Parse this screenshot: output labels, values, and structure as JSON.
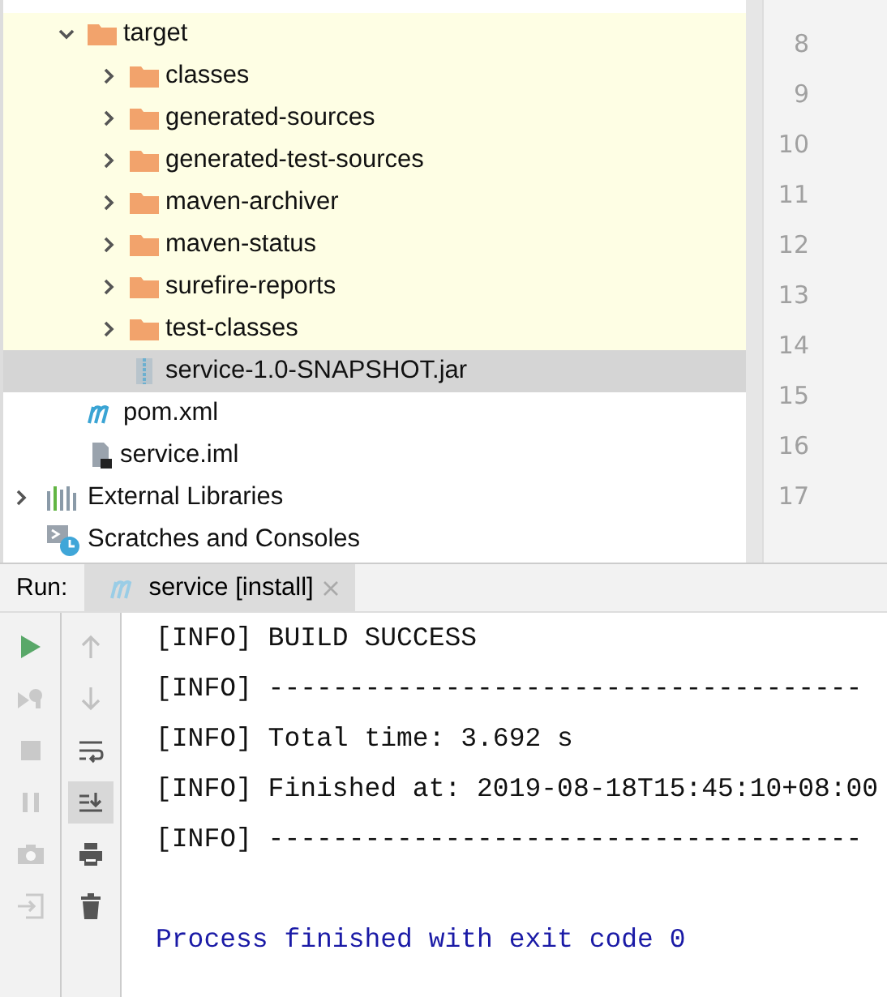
{
  "project_tree": {
    "module_items": [
      {
        "label": "target",
        "kind": "folder",
        "expanded": true,
        "excluded": true,
        "selected": false,
        "children": [
          {
            "label": "classes",
            "kind": "folder",
            "expanded": false,
            "excluded": true,
            "selected": false
          },
          {
            "label": "generated-sources",
            "kind": "folder",
            "expanded": false,
            "excluded": true,
            "selected": false
          },
          {
            "label": "generated-test-sources",
            "kind": "folder",
            "expanded": false,
            "excluded": true,
            "selected": false
          },
          {
            "label": "maven-archiver",
            "kind": "folder",
            "expanded": false,
            "excluded": true,
            "selected": false
          },
          {
            "label": "maven-status",
            "kind": "folder",
            "expanded": false,
            "excluded": true,
            "selected": false
          },
          {
            "label": "surefire-reports",
            "kind": "folder",
            "expanded": false,
            "excluded": true,
            "selected": false
          },
          {
            "label": "test-classes",
            "kind": "folder",
            "expanded": false,
            "excluded": true,
            "selected": false
          },
          {
            "label": "service-1.0-SNAPSHOT.jar",
            "kind": "jar",
            "excluded": true,
            "selected": true
          }
        ]
      },
      {
        "label": "pom.xml",
        "kind": "maven",
        "excluded": false,
        "selected": false
      },
      {
        "label": "service.iml",
        "kind": "iml",
        "excluded": false,
        "selected": false
      }
    ],
    "root_items": [
      {
        "label": "External Libraries",
        "kind": "libraries",
        "expanded": false,
        "selected": false
      },
      {
        "label": "Scratches and Consoles",
        "kind": "scratches",
        "selected": false
      }
    ]
  },
  "editor": {
    "line_numbers": [
      "8",
      "9",
      "10",
      "11",
      "12",
      "13",
      "14",
      "15",
      "16",
      "17"
    ]
  },
  "run_panel": {
    "title": "Run:",
    "tabs": [
      {
        "label": "service [install]",
        "selected": true
      }
    ],
    "run_toolbar": [
      {
        "kind": "run",
        "disabled": false
      },
      {
        "kind": "rerun-failed",
        "disabled": true
      },
      {
        "kind": "stop",
        "disabled": true
      },
      {
        "kind": "pause",
        "disabled": true
      },
      {
        "kind": "camera",
        "disabled": true
      },
      {
        "kind": "exit",
        "disabled": true
      }
    ],
    "console_toolbar": [
      {
        "kind": "up",
        "disabled": true,
        "on": false
      },
      {
        "kind": "down",
        "disabled": true,
        "on": false
      },
      {
        "kind": "wrap",
        "disabled": false,
        "on": false
      },
      {
        "kind": "scroll-end",
        "disabled": false,
        "on": true
      },
      {
        "kind": "print",
        "disabled": false,
        "on": false
      },
      {
        "kind": "trash",
        "disabled": false,
        "on": false
      }
    ],
    "console_lines": [
      {
        "text": "[INFO] BUILD SUCCESS",
        "kind": "info"
      },
      {
        "text": "[INFO] -------------------------------------",
        "kind": "info"
      },
      {
        "text": "[INFO] Total time: 3.692 s",
        "kind": "info"
      },
      {
        "text": "[INFO] Finished at: 2019-08-18T15:45:10+08:00",
        "kind": "info"
      },
      {
        "text": "[INFO] -------------------------------------",
        "kind": "info"
      },
      {
        "text": "Process finished with exit code 0",
        "kind": "exit"
      }
    ]
  }
}
